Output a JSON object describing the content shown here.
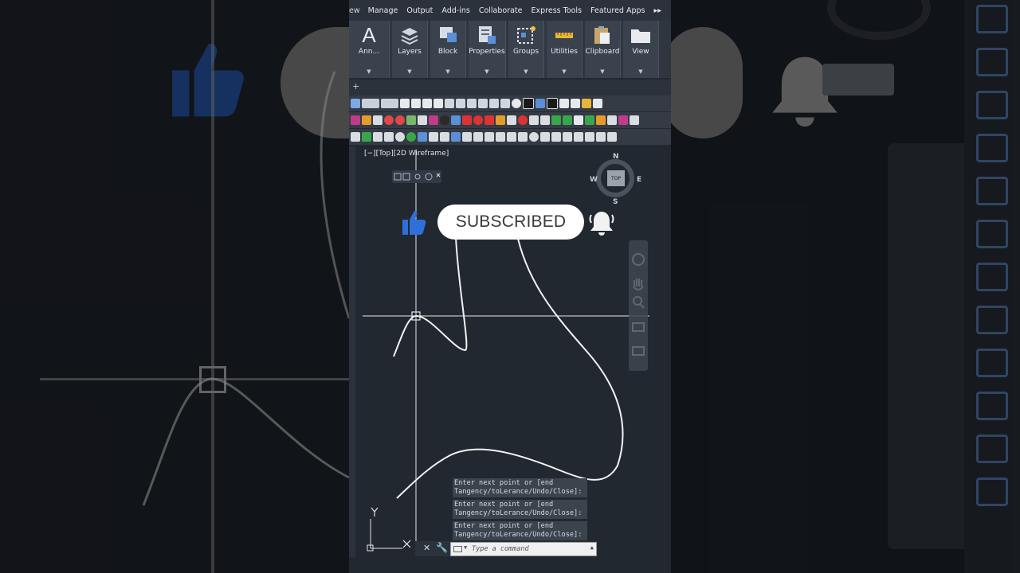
{
  "menu": {
    "lead": "ew",
    "items": [
      "Manage",
      "Output",
      "Add-ins",
      "Collaborate",
      "Express Tools",
      "Featured Apps"
    ]
  },
  "ribbon": {
    "panels": [
      {
        "label": "Ann...",
        "icon": "annotation-icon"
      },
      {
        "label": "Layers",
        "icon": "layers-icon"
      },
      {
        "label": "Block",
        "icon": "block-icon"
      },
      {
        "label": "Properties",
        "icon": "properties-icon"
      },
      {
        "label": "Groups",
        "icon": "groups-icon"
      },
      {
        "label": "Utilities",
        "icon": "utilities-icon"
      },
      {
        "label": "Clipboard",
        "icon": "clipboard-icon"
      },
      {
        "label": "View",
        "icon": "view-icon"
      }
    ]
  },
  "viewport": {
    "label": "[−][Top][2D Wireframe]"
  },
  "viewcube": {
    "north": "N",
    "south": "S",
    "east": "E",
    "west": "W",
    "face": "TOP"
  },
  "overlay": {
    "subscribe_label": "SUBSCRIBED"
  },
  "ucs": {
    "x": "X",
    "y": "Y"
  },
  "command": {
    "history": [
      "Enter next point or [end Tangency/toLerance/Undo/Close]:",
      "Enter next point or [end Tangency/toLerance/Undo/Close]:",
      "Enter next point or [end Tangency/toLerance/Undo/Close]:"
    ],
    "placeholder": "Type a command"
  },
  "colors": {
    "background": "#212830",
    "ribbon": "#3a424d",
    "accent_blue": "#2f6fd8",
    "spline": "#f2f2f2"
  }
}
